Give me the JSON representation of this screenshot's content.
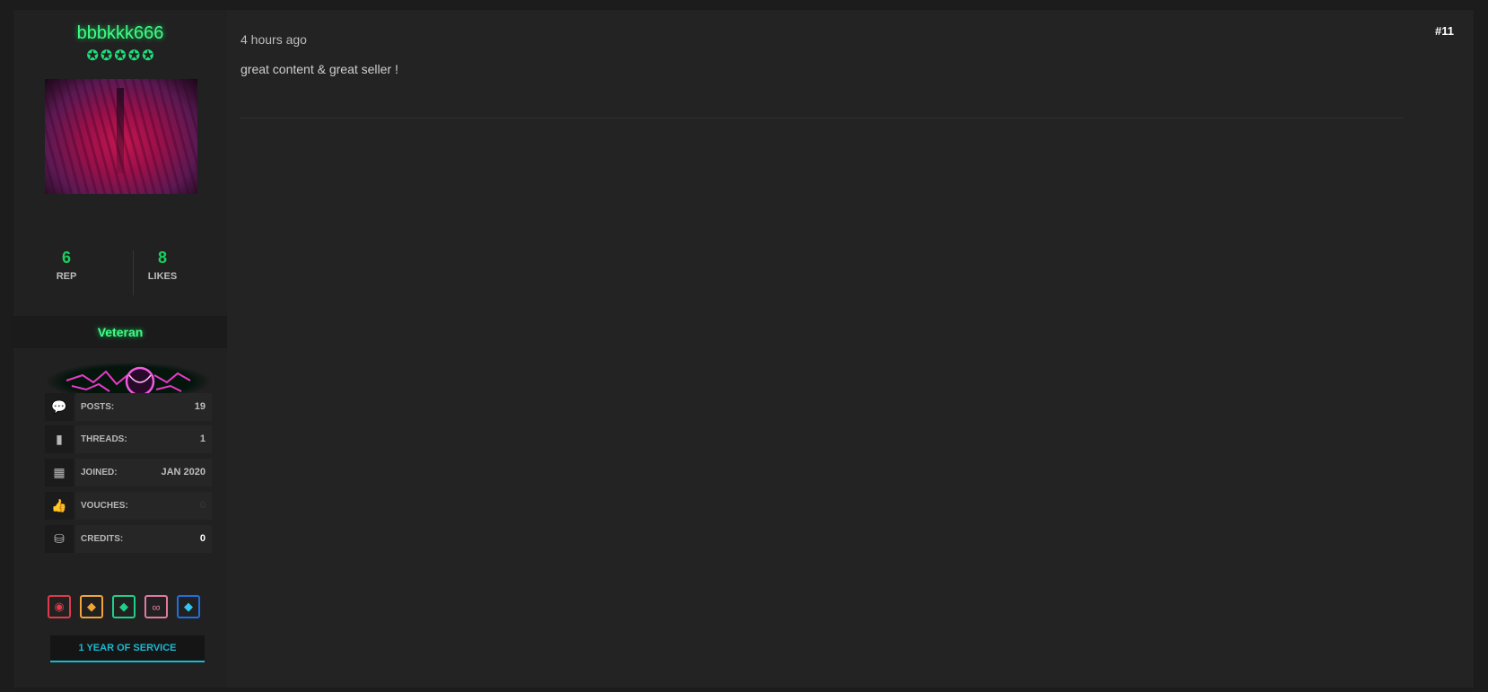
{
  "post": {
    "number": "#11",
    "timestamp": "4 hours ago",
    "content": "great content & great seller !"
  },
  "user": {
    "username": "bbbkkk666",
    "stars": 5,
    "rep": {
      "value": "6",
      "label": "REP"
    },
    "likes": {
      "value": "8",
      "label": "LIKES"
    },
    "rank": "Veteran",
    "info": [
      {
        "icon": "comments-icon",
        "glyph": "💬",
        "label": "POSTS:",
        "value": "19"
      },
      {
        "icon": "book-icon",
        "glyph": "▮",
        "label": "THREADS:",
        "value": "1"
      },
      {
        "icon": "calendar-icon",
        "glyph": "▦",
        "label": "JOINED:",
        "value": "JAN 2020"
      },
      {
        "icon": "thumbs-up-icon",
        "glyph": "👍",
        "label": "VOUCHES:",
        "value": "0"
      },
      {
        "icon": "coins-icon",
        "glyph": "⛁",
        "label": "CREDITS:",
        "value": "0"
      }
    ],
    "badges": [
      {
        "icon": "hacker-badge-icon",
        "color": "#e03a4a"
      },
      {
        "icon": "orange-diamond-badge-icon",
        "color": "#f0a43a"
      },
      {
        "icon": "green-diamond-badge-icon",
        "color": "#1fd08a"
      },
      {
        "icon": "infinity-badge-icon",
        "color": "#e07aa0"
      },
      {
        "icon": "blue-diamond-badge-icon",
        "color": "#1f6fe0"
      }
    ],
    "service": "1 YEAR OF SERVICE"
  },
  "colors": {
    "accent_green": "#19d05f",
    "service_cyan": "#1ab8d0",
    "corner_red": "#e0141a"
  }
}
